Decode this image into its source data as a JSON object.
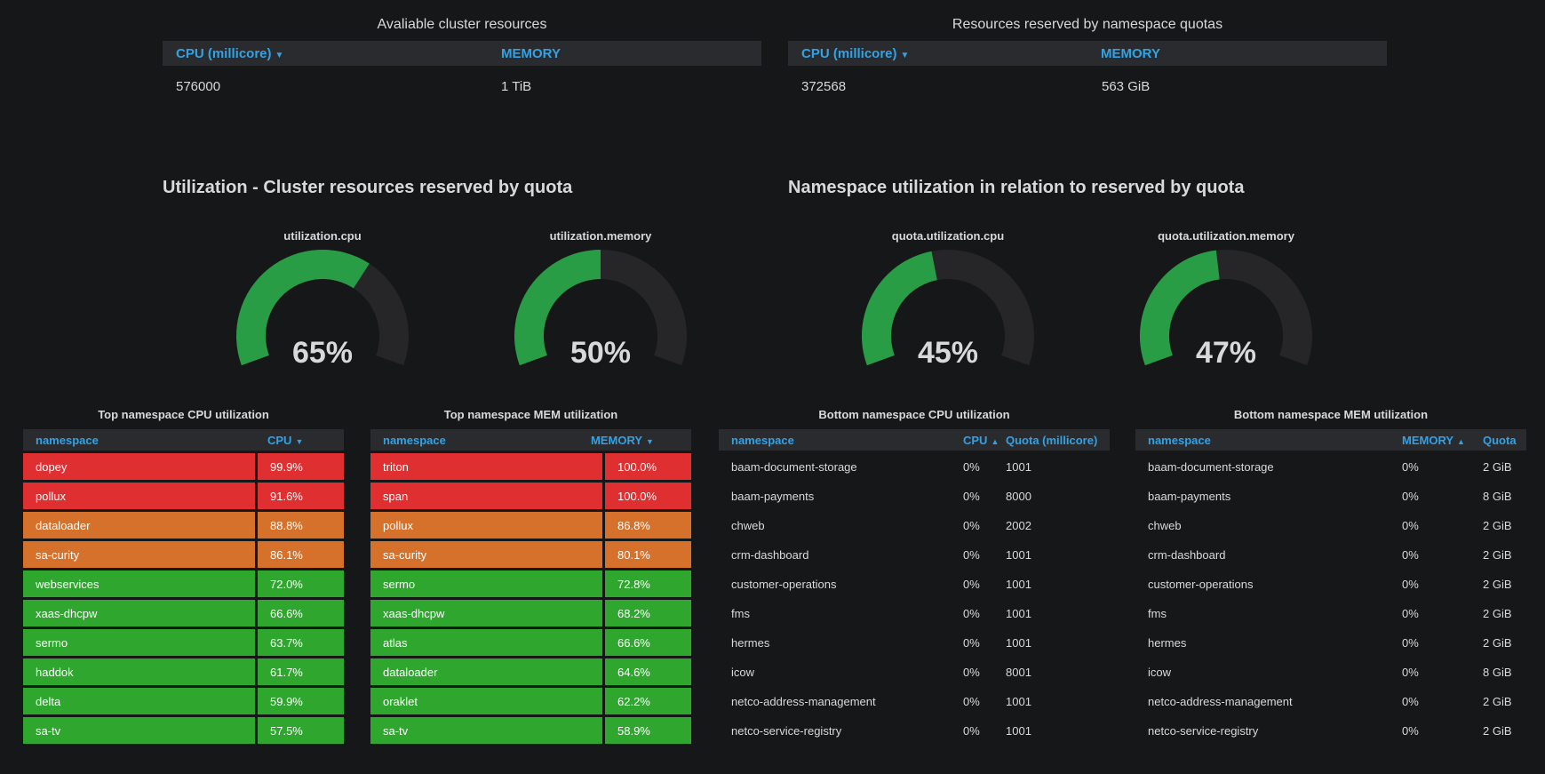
{
  "top": {
    "available": {
      "title": "Avaliable cluster resources",
      "col_cpu": "CPU (millicore)",
      "col_mem": "MEMORY",
      "cpu": "576000",
      "mem": "1 TiB"
    },
    "reserved": {
      "title": "Resources reserved by namespace quotas",
      "col_cpu": "CPU (millicore)",
      "col_mem": "MEMORY",
      "cpu": "372568",
      "mem": "563 GiB"
    }
  },
  "sections": {
    "left": "Utilization - Cluster resources reserved by quota",
    "right": "Namespace utilization in relation to reserved by quota"
  },
  "gauges": [
    {
      "label": "utilization.cpu",
      "value": 65,
      "display": "65%"
    },
    {
      "label": "utilization.memory",
      "value": 50,
      "display": "50%"
    },
    {
      "label": "quota.utilization.cpu",
      "value": 45,
      "display": "45%"
    },
    {
      "label": "quota.utilization.memory",
      "value": 47,
      "display": "47%"
    }
  ],
  "colors": {
    "red": "#e02f30",
    "orange": "#d6712b",
    "green": "#2fa72f",
    "gauge_green": "#299c46",
    "gauge_track": "#262628",
    "header_blue": "#33a2e5"
  },
  "top_cpu": {
    "title": "Top namespace CPU utilization",
    "col_ns": "namespace",
    "col_val": "CPU",
    "rows": [
      {
        "ns": "dopey",
        "val": "99.9%",
        "level": "red"
      },
      {
        "ns": "pollux",
        "val": "91.6%",
        "level": "red"
      },
      {
        "ns": "dataloader",
        "val": "88.8%",
        "level": "orange"
      },
      {
        "ns": "sa-curity",
        "val": "86.1%",
        "level": "orange"
      },
      {
        "ns": "webservices",
        "val": "72.0%",
        "level": "green"
      },
      {
        "ns": "xaas-dhcpw",
        "val": "66.6%",
        "level": "green"
      },
      {
        "ns": "sermo",
        "val": "63.7%",
        "level": "green"
      },
      {
        "ns": "haddok",
        "val": "61.7%",
        "level": "green"
      },
      {
        "ns": "delta",
        "val": "59.9%",
        "level": "green"
      },
      {
        "ns": "sa-tv",
        "val": "57.5%",
        "level": "green"
      }
    ]
  },
  "top_mem": {
    "title": "Top namespace MEM utilization",
    "col_ns": "namespace",
    "col_val": "MEMORY",
    "rows": [
      {
        "ns": "triton",
        "val": "100.0%",
        "level": "red"
      },
      {
        "ns": "span",
        "val": "100.0%",
        "level": "red"
      },
      {
        "ns": "pollux",
        "val": "86.8%",
        "level": "orange"
      },
      {
        "ns": "sa-curity",
        "val": "80.1%",
        "level": "orange"
      },
      {
        "ns": "sermo",
        "val": "72.8%",
        "level": "green"
      },
      {
        "ns": "xaas-dhcpw",
        "val": "68.2%",
        "level": "green"
      },
      {
        "ns": "atlas",
        "val": "66.6%",
        "level": "green"
      },
      {
        "ns": "dataloader",
        "val": "64.6%",
        "level": "green"
      },
      {
        "ns": "oraklet",
        "val": "62.2%",
        "level": "green"
      },
      {
        "ns": "sa-tv",
        "val": "58.9%",
        "level": "green"
      }
    ]
  },
  "bottom_cpu": {
    "title": "Bottom namespace CPU utilization",
    "col_ns": "namespace",
    "col_val": "CPU",
    "col_quota": "Quota (millicore)",
    "rows": [
      {
        "ns": "baam-document-storage",
        "val": "0%",
        "quota": "1001"
      },
      {
        "ns": "baam-payments",
        "val": "0%",
        "quota": "8000"
      },
      {
        "ns": "chweb",
        "val": "0%",
        "quota": "2002"
      },
      {
        "ns": "crm-dashboard",
        "val": "0%",
        "quota": "1001"
      },
      {
        "ns": "customer-operations",
        "val": "0%",
        "quota": "1001"
      },
      {
        "ns": "fms",
        "val": "0%",
        "quota": "1001"
      },
      {
        "ns": "hermes",
        "val": "0%",
        "quota": "1001"
      },
      {
        "ns": "icow",
        "val": "0%",
        "quota": "8001"
      },
      {
        "ns": "netco-address-management",
        "val": "0%",
        "quota": "1001"
      },
      {
        "ns": "netco-service-registry",
        "val": "0%",
        "quota": "1001"
      }
    ]
  },
  "bottom_mem": {
    "title": "Bottom namespace MEM utilization",
    "col_ns": "namespace",
    "col_val": "MEMORY",
    "col_quota": "Quota",
    "rows": [
      {
        "ns": "baam-document-storage",
        "val": "0%",
        "quota": "2 GiB"
      },
      {
        "ns": "baam-payments",
        "val": "0%",
        "quota": "8 GiB"
      },
      {
        "ns": "chweb",
        "val": "0%",
        "quota": "2 GiB"
      },
      {
        "ns": "crm-dashboard",
        "val": "0%",
        "quota": "2 GiB"
      },
      {
        "ns": "customer-operations",
        "val": "0%",
        "quota": "2 GiB"
      },
      {
        "ns": "fms",
        "val": "0%",
        "quota": "2 GiB"
      },
      {
        "ns": "hermes",
        "val": "0%",
        "quota": "2 GiB"
      },
      {
        "ns": "icow",
        "val": "0%",
        "quota": "8 GiB"
      },
      {
        "ns": "netco-address-management",
        "val": "0%",
        "quota": "2 GiB"
      },
      {
        "ns": "netco-service-registry",
        "val": "0%",
        "quota": "2 GiB"
      }
    ]
  }
}
